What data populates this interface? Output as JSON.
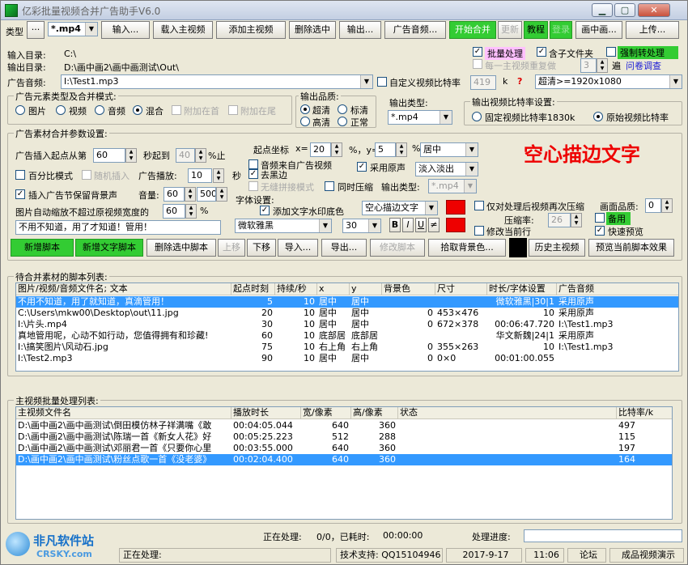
{
  "window": {
    "title": "亿彩批量视频合并广告助手V6.0"
  },
  "toolbar": {
    "type_label": "类型",
    "type_value": "*.mp4",
    "input_btn": "输入...",
    "load_main": "载入主视频",
    "add_main": "添加主视频",
    "delete_selected": "删除选中",
    "output_btn": "输出...",
    "ad_audio_btn": "广告音频...",
    "start_merge": "开始合并",
    "update": "更新",
    "tutorial": "教程",
    "login": "登录",
    "pip": "画中画...",
    "upload": "上传..."
  },
  "dirs": {
    "input_label": "输入目录:",
    "input_value": "C:\\",
    "output_label": "输出目录:",
    "output_value": "D:\\画中画2\\画中画测试\\Out\\"
  },
  "batch": {
    "batch_label": "批量处理",
    "subfolder_label": "含子文件夹",
    "force_label": "强制转处理",
    "repeat_label": "每一主视频重复做",
    "repeat_count": "3",
    "repeat_unit": "遍",
    "survey_link": "问卷调查"
  },
  "ad_audio": {
    "label": "广告音频:",
    "value": "I:\\Test1.mp3",
    "custom_bitrate_label": "自定义视频比特率",
    "bitrate_value": "419",
    "bitrate_unit": "k",
    "help": "?",
    "quality_value": "超清>=1920x1080"
  },
  "ad_type": {
    "title": "广告元素类型及合并模式:",
    "image": "图片",
    "video": "视频",
    "audio": "音频",
    "mixed": "混合",
    "append_head": "附加在首",
    "append_tail": "附加在尾"
  },
  "out_quality": {
    "title": "输出品质:",
    "super": "超清",
    "standard": "标清",
    "high": "高清",
    "normal": "正常"
  },
  "out_type": {
    "title": "输出类型:",
    "value": "*.mp4"
  },
  "bitrate_setting": {
    "title": "输出视频比特率设置:",
    "fixed": "固定视频比特率1830k",
    "original": "原始视频比特率"
  },
  "material": {
    "title": "广告素材合并参数设置:",
    "insert_from_label": "广告插入起点从第",
    "insert_from_value": "60",
    "sec_to_label": "秒起到",
    "sec_to_value": "40",
    "percent_end": "%止",
    "percent_mode": "百分比模式",
    "random_insert": "随机插入",
    "ad_play_label": "广告播放:",
    "ad_play_value": "10",
    "sec_unit": "秒",
    "keep_bg": "插入广告节保留背景声",
    "volume_label": "音量:",
    "volume_value": "60",
    "volume_value2": "500",
    "auto_scale_label": "图片自动缩放不超过原视频宽度的",
    "auto_scale_value": "60",
    "pct": "%",
    "text_value": "不用不知道，用了才知道！管用！",
    "start_coord_label": "起点坐标",
    "x_label": "x=",
    "x_value": "20",
    "pct_y_label": "%，y=",
    "y_value": "5",
    "pct2": "%",
    "align_value": "居中",
    "audio_from_ad": "音频来自广告视频",
    "remove_black": "去黑边",
    "use_original": "采用原声",
    "fade_value": "淡入淡出",
    "seamless": "无缝拼接模式",
    "sync_compress": "同时压缩",
    "output_type_label": "输出类型:",
    "output_type_value": "*.mp4",
    "font_setting": "字体设置:",
    "add_watermark": "添加文字水印底色",
    "font_style_value": "空心描边文字",
    "font_name": "微软雅黑",
    "font_size": "30",
    "bold": "B",
    "italic": "I",
    "underline": "U",
    "strike": "≠",
    "preview_text": "空心描边文字",
    "only_recompress": "仅对处理后视频再次压缩",
    "quality_label": "画面品质:",
    "quality_value": "0",
    "compress_label": "压缩率:",
    "compress_value": "26",
    "spare": "备用",
    "modify_current": "修改当前行",
    "fast_preview": "快速预览"
  },
  "script_buttons": {
    "new_script": "新增脚本",
    "new_text_script": "新增文字脚本",
    "delete_script": "删除选中脚本",
    "up": "上移",
    "down": "下移",
    "import": "导入...",
    "export": "导出...",
    "edit_script": "修改脚本",
    "pick_bg": "拾取背景色...",
    "history": "历史主视频",
    "preview_effect": "预览当前脚本效果"
  },
  "script_list": {
    "title": "待合并素材的脚本列表:",
    "headers": [
      "图片/视频/音频文件名; 文本",
      "起点时刻",
      "持续/秒",
      "x",
      "y",
      "背景色",
      "尺寸",
      "时长/字体设置",
      "广告音频"
    ],
    "rows": [
      [
        "不用不知道，用了就知道，真滴管用！",
        "5",
        "10",
        "居中",
        "居中",
        "",
        "",
        "微软雅黑|30|1",
        "采用原声"
      ],
      [
        "C:\\Users\\mkw00\\Desktop\\out\\11.jpg",
        "20",
        "10",
        "居中",
        "居中",
        "0",
        "453×476",
        "10",
        "采用原声"
      ],
      [
        "I:\\片头.mp4",
        "30",
        "10",
        "居中",
        "居中",
        "0",
        "672×378",
        "00:06:47.720",
        "I:\\Test1.mp3"
      ],
      [
        "真地管用呢，心动不如行动，您值得拥有和珍藏!",
        "60",
        "10",
        "底部居",
        "底部居",
        "",
        "",
        "华文新魏|24|1",
        "采用原声"
      ],
      [
        "I:\\搞笑图片\\风动石.jpg",
        "75",
        "10",
        "右上角",
        "右上角",
        "0",
        "355×263",
        "10",
        "I:\\Test1.mp3"
      ],
      [
        "I:\\Test2.mp3",
        "90",
        "10",
        "居中",
        "居中",
        "0",
        "0×0",
        "00:01:00.055",
        ""
      ]
    ]
  },
  "main_list": {
    "title": "主视频批量处理列表:",
    "headers": [
      "主视频文件名",
      "播放时长",
      "宽/像素",
      "高/像素",
      "状态",
      "比特率/k"
    ],
    "rows": [
      [
        "D:\\画中画2\\画中画测试\\倒田模仿林子祥满嘴《敢",
        "00:04:05.044",
        "640",
        "360",
        "",
        "497"
      ],
      [
        "D:\\画中画2\\画中画测试\\陈瑞一首《新女人花》好",
        "00:05:25.223",
        "512",
        "288",
        "",
        "115"
      ],
      [
        "D:\\画中画2\\画中画测试\\邓丽君一首《只要你心里",
        "00:03:55.000",
        "640",
        "360",
        "",
        "197"
      ],
      [
        "D:\\画中画2\\画中画测试\\粉丝点歌一首《没老婆》",
        "00:02:04.400",
        "640",
        "360",
        "",
        "164"
      ]
    ]
  },
  "progress": {
    "processing_label": "正在处理:",
    "processing_value": "0/0，已耗时:",
    "elapsed": "00:00:00",
    "progress_label": "处理进度:"
  },
  "statusbar": {
    "processing": "正在处理:",
    "support": "技术支持: QQ15104946",
    "date": "2017-9-17",
    "time": "11:06",
    "forum": "论坛",
    "demo": "成品视频演示"
  },
  "watermark": {
    "logo_text": "非凡软件站",
    "logo_sub": "CRSKY.com"
  },
  "colors": {
    "accent_green": "#33cc33",
    "selection": "#3399ff",
    "red": "#ee0000",
    "black": "#000000"
  }
}
